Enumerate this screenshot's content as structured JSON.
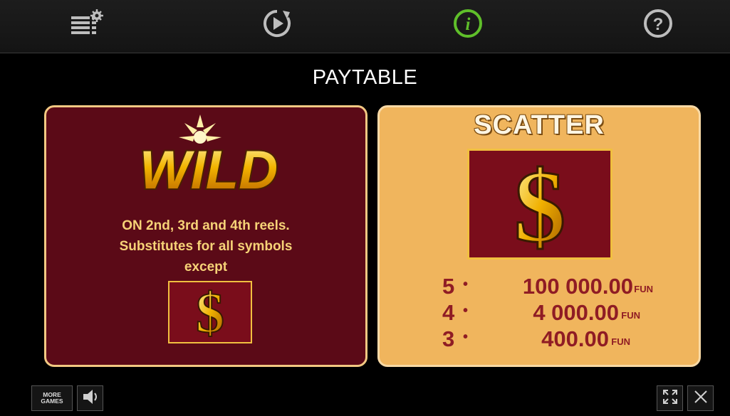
{
  "toolbar": {
    "settings_icon": "settings-stack-icon",
    "autoplay_icon": "autoplay-icon",
    "info_icon": "info-icon",
    "help_icon": "help-icon",
    "active_color": "#5fbf2a"
  },
  "page": {
    "title": "PAYTABLE"
  },
  "wild_panel": {
    "logo_text": "WILD",
    "description_lines": [
      "ON 2nd, 3rd and 4th reels.",
      "Substitutes for all symbols",
      "except"
    ]
  },
  "scatter_panel": {
    "title": "SCATTER",
    "payouts": [
      {
        "count": "5",
        "value": "100 000.00",
        "currency": "FUN"
      },
      {
        "count": "4",
        "value": "4 000.00",
        "currency": "FUN"
      },
      {
        "count": "3",
        "value": "400.00",
        "currency": "FUN"
      }
    ]
  },
  "bottom_bar": {
    "more_games_line1": "MORE",
    "more_games_line2": "GAMES",
    "sound_icon": "speaker-icon",
    "fullscreen_icon": "fullscreen-icon",
    "close_icon": "close-icon"
  },
  "colors": {
    "wild_panel_bg": "#5b0a17",
    "scatter_panel_bg": "#f0b55d",
    "payout_text": "#8f1c24",
    "description_text": "#f6d277"
  }
}
